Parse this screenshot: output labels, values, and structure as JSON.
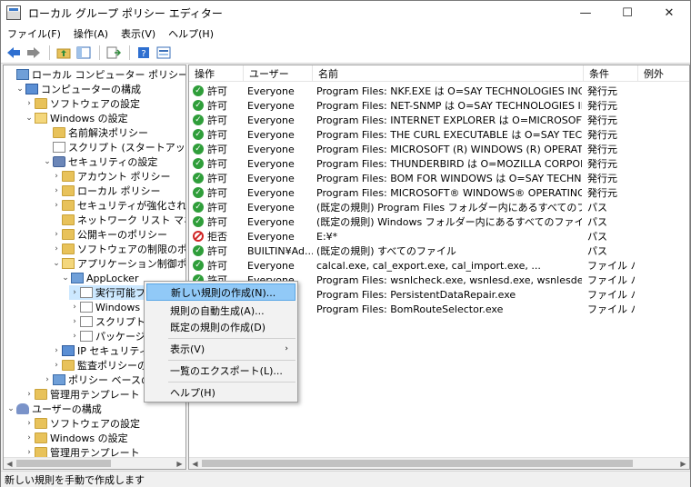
{
  "window": {
    "title": "ローカル グループ ポリシー エディター",
    "min_glyph": "—",
    "max_glyph": "☐",
    "close_glyph": "✕"
  },
  "menubar": {
    "file": "ファイル(F)",
    "action": "操作(A)",
    "view": "表示(V)",
    "help": "ヘルプ(H)"
  },
  "toolbar": {
    "icons": [
      "back-icon",
      "forward-icon",
      "up-folder-icon",
      "show-hide-tree-icon",
      "export-list-icon",
      "help-icon",
      "properties-icon"
    ]
  },
  "tree": [
    {
      "label": "ローカル コンピューター ポリシー",
      "icon": "policy",
      "expander": ""
    },
    {
      "label": "コンピューターの構成",
      "icon": "computer",
      "expander": "⌄"
    },
    {
      "label": "ソフトウェアの設定",
      "icon": "folder",
      "expander": "›"
    },
    {
      "label": "Windows の設定",
      "icon": "folder-open",
      "expander": "⌄"
    },
    {
      "label": "名前解決ポリシー",
      "icon": "folder",
      "expander": ""
    },
    {
      "label": "スクリプト (スタートアップ/シャットダウン)",
      "icon": "doc",
      "expander": ""
    },
    {
      "label": "セキュリティの設定",
      "icon": "shield",
      "expander": "⌄"
    },
    {
      "label": "アカウント ポリシー",
      "icon": "folder",
      "expander": "›"
    },
    {
      "label": "ローカル ポリシー",
      "icon": "folder",
      "expander": "›"
    },
    {
      "label": "セキュリティが強化された Windows Defender ファイアウォール",
      "icon": "folder",
      "expander": "›"
    },
    {
      "label": "ネットワーク リスト マネージャー ポリシー",
      "icon": "folder",
      "expander": ""
    },
    {
      "label": "公開キーのポリシー",
      "icon": "folder",
      "expander": "›"
    },
    {
      "label": "ソフトウェアの制限のポリシー",
      "icon": "folder",
      "expander": "›"
    },
    {
      "label": "アプリケーション制御ポリシー",
      "icon": "folder-open",
      "expander": "⌄"
    },
    {
      "label": "AppLocker",
      "icon": "policy",
      "expander": "⌄"
    },
    {
      "label": "実行可能ファイルの規則",
      "icon": "doc",
      "expander": "›"
    },
    {
      "label": "Windows インストーラーの規則",
      "icon": "doc",
      "expander": "›"
    },
    {
      "label": "スクリプトの規則",
      "icon": "doc",
      "expander": "›"
    },
    {
      "label": "パッケージアプリの規則",
      "icon": "doc",
      "expander": "›"
    },
    {
      "label": "IP セキュリティ ポリシー",
      "icon": "computer",
      "expander": "›"
    },
    {
      "label": "監査ポリシーの詳細な構成",
      "icon": "folder",
      "expander": "›"
    },
    {
      "label": "ポリシー ベースの QoS",
      "icon": "policy",
      "expander": "›"
    },
    {
      "label": "管理用テンプレート",
      "icon": "folder",
      "expander": "›"
    },
    {
      "label": "ユーザーの構成",
      "icon": "userico",
      "expander": "⌄"
    },
    {
      "label": "ソフトウェアの設定",
      "icon": "folder",
      "expander": "›"
    },
    {
      "label": "Windows の設定",
      "icon": "folder",
      "expander": "›"
    },
    {
      "label": "管理用テンプレート",
      "icon": "folder",
      "expander": "›"
    }
  ],
  "list": {
    "headers": {
      "action": "操作",
      "user": "ユーザー",
      "name": "名前",
      "condition": "条件",
      "exception": "例外"
    },
    "rows": [
      {
        "action": "許可",
        "status": "allow",
        "user": "Everyone",
        "name": "Program Files: NKF.EXE は O=SAY TECHNOLOGIES INC., L=BUN...",
        "condition": "発行元"
      },
      {
        "action": "許可",
        "status": "allow",
        "user": "Everyone",
        "name": "Program Files: NET-SNMP は O=SAY TECHNOLOGIES INC., L=B...",
        "condition": "発行元"
      },
      {
        "action": "許可",
        "status": "allow",
        "user": "Everyone",
        "name": "Program Files: INTERNET EXPLORER は O=MICROSOFT CORPOR...",
        "condition": "発行元"
      },
      {
        "action": "許可",
        "status": "allow",
        "user": "Everyone",
        "name": "Program Files: THE CURL EXECUTABLE は O=SAY TECHNOLOGIE...",
        "condition": "発行元"
      },
      {
        "action": "許可",
        "status": "allow",
        "user": "Everyone",
        "name": "Program Files: MICROSOFT (R) WINDOWS (R) OPERATING SYST...",
        "condition": "発行元"
      },
      {
        "action": "許可",
        "status": "allow",
        "user": "Everyone",
        "name": "Program Files: THUNDERBIRD は O=MOZILLA CORPORATION, ...",
        "condition": "発行元"
      },
      {
        "action": "許可",
        "status": "allow",
        "user": "Everyone",
        "name": "Program Files: BOM FOR WINDOWS は O=SAY TECHNOLOGIES ...",
        "condition": "発行元"
      },
      {
        "action": "許可",
        "status": "allow",
        "user": "Everyone",
        "name": "Program Files: MICROSOFT® WINDOWS® OPERATING SYSTE...",
        "condition": "発行元"
      },
      {
        "action": "許可",
        "status": "allow",
        "user": "Everyone",
        "name": "(既定の規則) Program Files フォルダー内にあるすべてのファイル",
        "condition": "パス"
      },
      {
        "action": "許可",
        "status": "allow",
        "user": "Everyone",
        "name": "(既定の規則) Windows フォルダー内にあるすべてのファイル",
        "condition": "パス"
      },
      {
        "action": "拒否",
        "status": "deny",
        "user": "Everyone",
        "name": "E:¥*",
        "condition": "パス"
      },
      {
        "action": "許可",
        "status": "allow",
        "user": "BUILTIN¥Ad...",
        "name": "(既定の規則) すべてのファイル",
        "condition": "パス"
      },
      {
        "action": "許可",
        "status": "allow",
        "user": "Everyone",
        "name": "calcal.exe, cal_export.exe, cal_import.exe, ...",
        "condition": "ファイル ハ..."
      },
      {
        "action": "許可",
        "status": "allow",
        "user": "Everyone",
        "name": "Program Files: wsnlcheck.exe, wsnlesd.exe, wsnlesdex.exe...",
        "condition": "ファイル ハ..."
      },
      {
        "action": "許可",
        "status": "allow",
        "user": "Everyone",
        "name": "Program Files: PersistentDataRepair.exe",
        "condition": "ファイル ハ..."
      },
      {
        "action": "許可",
        "status": "allow",
        "user": "Everyone",
        "name": "Program Files: BomRouteSelector.exe",
        "condition": "ファイル ハ..."
      }
    ]
  },
  "context_menu": {
    "items": [
      {
        "label": "新しい規則の作成(N)...",
        "highlighted": true
      },
      {
        "label": "規則の自動生成(A)..."
      },
      {
        "label": "既定の規則の作成(D)"
      },
      {
        "label": "表示(V)",
        "submenu": "›"
      },
      {
        "label": "一覧のエクスポート(L)..."
      },
      {
        "label": "ヘルプ(H)"
      }
    ]
  },
  "statusbar": {
    "text": "新しい規則を手動で作成します"
  },
  "colors": {
    "selection": "#cce8ff",
    "menu_highlight": "#91c9f7",
    "allow": "#2f9e3a",
    "deny": "#d12727"
  }
}
